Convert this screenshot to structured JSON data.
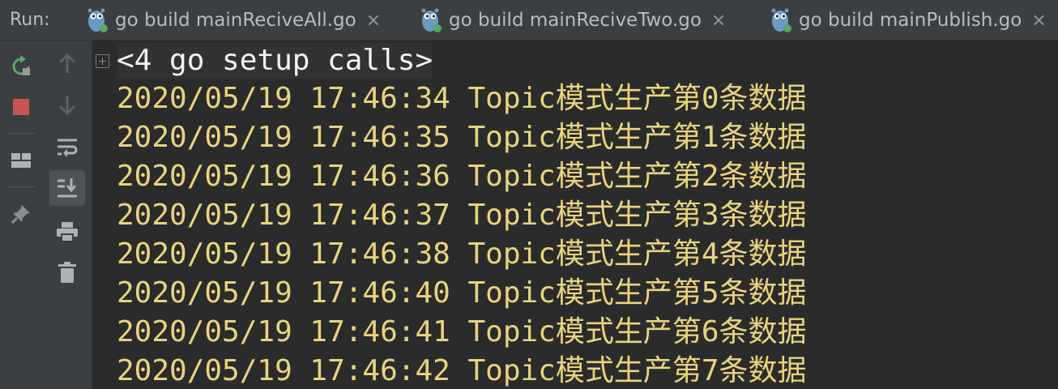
{
  "run_label": "Run:",
  "tabs": [
    {
      "label": "go build mainReciveAll.go",
      "icon": "gopher-icon",
      "close": "×"
    },
    {
      "label": "go build mainReciveTwo.go",
      "icon": "gopher-icon",
      "close": "×"
    },
    {
      "label": "go build mainPublish.go",
      "icon": "gopher-icon",
      "close": "×"
    }
  ],
  "toolbar": {
    "rerun": "rerun-icon",
    "stop": "stop-icon",
    "layout": "layout-icon",
    "pin": "pin-icon",
    "up": "arrow-up-icon",
    "down": "arrow-down-icon",
    "soft_wrap": "soft-wrap-icon",
    "scroll_to_end": "scroll-to-end-icon",
    "print": "print-icon",
    "clear": "trash-icon"
  },
  "console": {
    "setup_calls": "<4 go setup calls>",
    "lines": [
      "2020/05/19 17:46:34 Topic模式生产第0条数据",
      "2020/05/19 17:46:35 Topic模式生产第1条数据",
      "2020/05/19 17:46:36 Topic模式生产第2条数据",
      "2020/05/19 17:46:37 Topic模式生产第3条数据",
      "2020/05/19 17:46:38 Topic模式生产第4条数据",
      "2020/05/19 17:46:40 Topic模式生产第5条数据",
      "2020/05/19 17:46:41 Topic模式生产第6条数据",
      "2020/05/19 17:46:42 Topic模式生产第7条数据"
    ]
  },
  "colors": {
    "background": "#2b2b2b",
    "panel": "#3c3f41",
    "log_text": "#e8d47f",
    "setup_text": "#f2f2f2",
    "rerun_green": "#59a869",
    "stop_red": "#c75450"
  }
}
